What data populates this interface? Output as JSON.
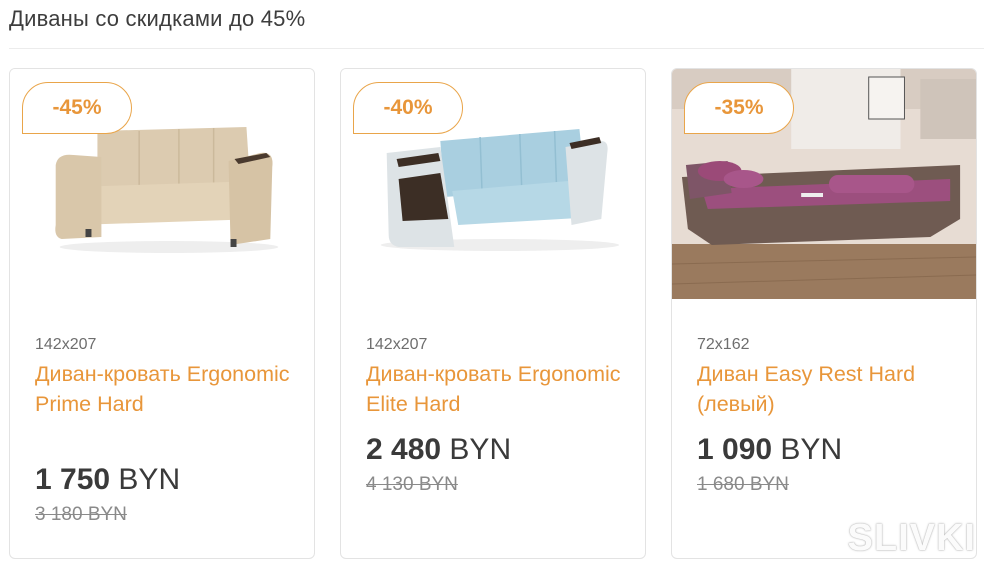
{
  "section": {
    "title": "Диваны со скидками до 45%"
  },
  "products": [
    {
      "badge": "-45%",
      "size": "142x207",
      "name": "Диван-кровать Ergonomic Prime Hard",
      "price_number": "1 750",
      "price_currency": "BYN",
      "old_price": "3 180 BYN"
    },
    {
      "badge": "-40%",
      "size": "142x207",
      "name": "Диван-кровать Ergonomic Elite Hard",
      "price_number": "2 480",
      "price_currency": "BYN",
      "old_price": "4 130 BYN"
    },
    {
      "badge": "-35%",
      "size": "72x162",
      "name": "Диван Easy Rest Hard (левый)",
      "price_number": "1 090",
      "price_currency": "BYN",
      "old_price": "1 680 BYN"
    }
  ],
  "watermark": "SLIVKI",
  "colors": {
    "accent": "#e8963a",
    "text": "#3a3a3a",
    "muted": "#8a8a8a",
    "border": "#e3e3e3"
  }
}
